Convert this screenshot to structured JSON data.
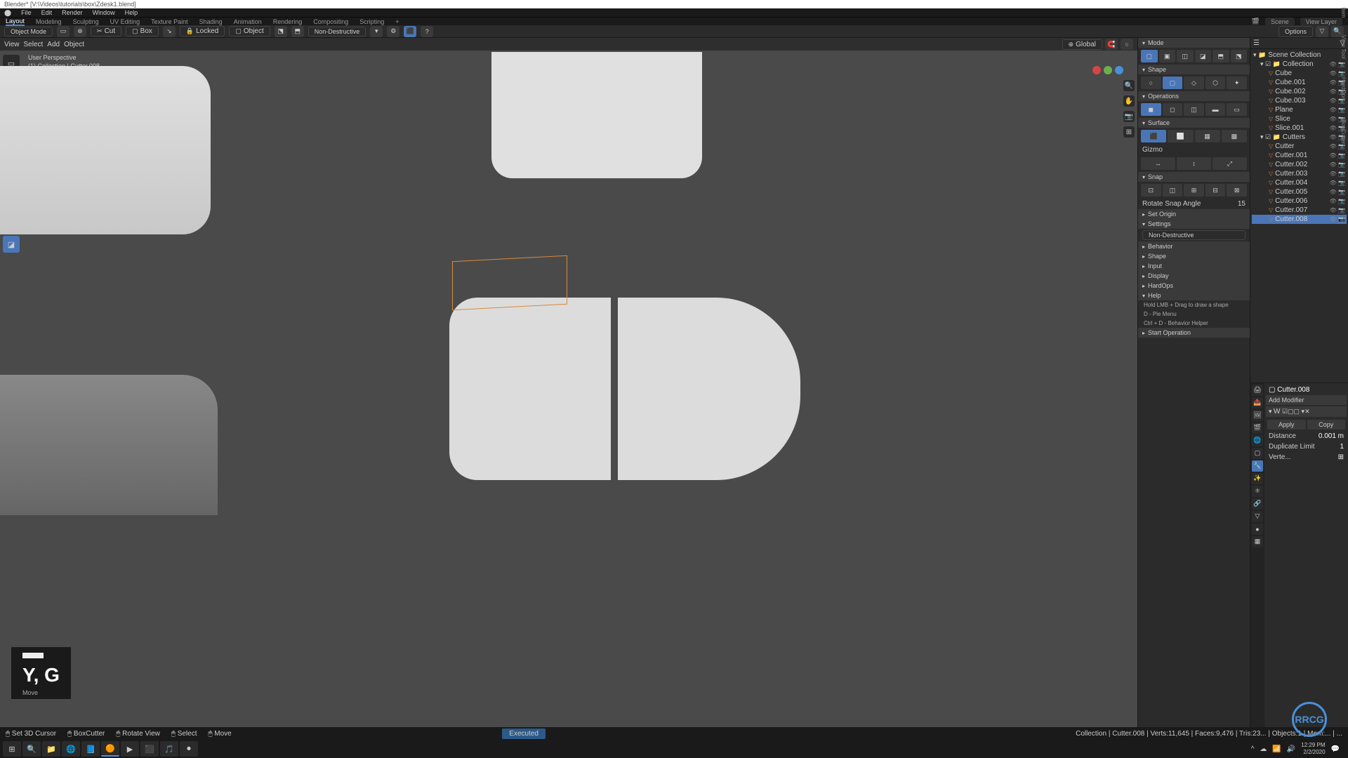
{
  "titlebar": {
    "text": "Blender* [V:\\Videos\\tutorials\\box\\Zdesk1.blend]"
  },
  "menubar": {
    "items": [
      "File",
      "Edit",
      "Render",
      "Window",
      "Help"
    ]
  },
  "tabbar": {
    "items": [
      "Layout",
      "Modeling",
      "Sculpting",
      "UV Editing",
      "Texture Paint",
      "Shading",
      "Animation",
      "Rendering",
      "Compositing",
      "Scripting",
      "+"
    ],
    "active": "Layout",
    "scene": "Scene",
    "viewlayer": "View Layer"
  },
  "toolbar": {
    "mode": "Object Mode",
    "cut": "Cut",
    "box": "Box",
    "locked": "Locked",
    "object": "Object",
    "nondestruct": "Non-Destructive",
    "options": "Options"
  },
  "viewport_header": {
    "items": [
      "View",
      "Select",
      "Add",
      "Object"
    ],
    "orient": "Global"
  },
  "vp_info": {
    "line1": "User Perspective",
    "line2": "(1) Collection | Cutter.008"
  },
  "key_overlay": {
    "keys": "Y, G",
    "mode": "Move"
  },
  "npanel": {
    "mode": "Mode",
    "shape": "Shape",
    "operations": "Operations",
    "surface": "Surface",
    "gizmo": "Gizmo",
    "snap": "Snap",
    "rotate_snap": "Rotate Snap Angle",
    "rotate_snap_val": "15",
    "set_origin": "Set Origin",
    "settings": "Settings",
    "nondestruct": "Non-Destructive",
    "behavior": "Behavior",
    "shape2": "Shape",
    "input": "Input",
    "display": "Display",
    "hardops": "HardOps",
    "help": "Help",
    "help1": "Hold LMB + Drag to draw a shape",
    "help2": "D - Pie Menu",
    "help3": "Ctrl + D - Behavior Helper",
    "start_op": "Start Operation"
  },
  "outliner": {
    "root": "Scene Collection",
    "collection": "Collection",
    "items": [
      "Cube",
      "Cube.001",
      "Cube.002",
      "Cube.003",
      "Plane",
      "Slice",
      "Slice.001"
    ],
    "cutters": "Cutters",
    "cutter_items": [
      "Cutter",
      "Cutter.001",
      "Cutter.002",
      "Cutter.003",
      "Cutter.004",
      "Cutter.005",
      "Cutter.006",
      "Cutter.007",
      "Cutter.008"
    ],
    "selected": "Cutter.008"
  },
  "properties": {
    "breadcrumb": "Cutter.008",
    "add_modifier": "Add Modifier",
    "weld": "W",
    "apply": "Apply",
    "copy": "Copy",
    "distance": "Distance",
    "distance_val": "0.001 m",
    "dup_limit": "Duplicate Limit",
    "dup_limit_val": "1",
    "verte": "Verte..."
  },
  "status": {
    "l1": "Set 3D Cursor",
    "l2": "BoxCutter",
    "l3": "Rotate View",
    "l4": "Select",
    "l5": "Move",
    "mid": "Executed",
    "right": "Collection | Cutter.008 | Verts:11,645 | Faces:9,476 | Tris:23... | Objects:1 | Mem:... | ..."
  },
  "clock": {
    "time": "12:29 PM",
    "date": "2/2/2020"
  }
}
